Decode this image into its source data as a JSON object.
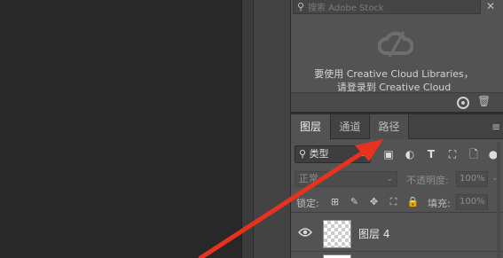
{
  "libraries": {
    "search_placeholder": "搜索 Adobe Stock",
    "message_line1": "要使用 Creative Cloud Libraries，",
    "message_line2": "请登录到 Creative Cloud"
  },
  "layers_panel": {
    "tabs": [
      {
        "label": "图层"
      },
      {
        "label": "通道"
      },
      {
        "label": "路径"
      }
    ],
    "filter_kind": "类型",
    "blend_mode": "正常",
    "opacity_label": "不透明度:",
    "opacity_value": "100%",
    "lock_label": "锁定:",
    "fill_label": "填充:",
    "fill_value": "100%",
    "layers": [
      {
        "name": "图层 4",
        "visible": true
      }
    ]
  },
  "annotation": {
    "arrow_color": "#e8321f"
  }
}
